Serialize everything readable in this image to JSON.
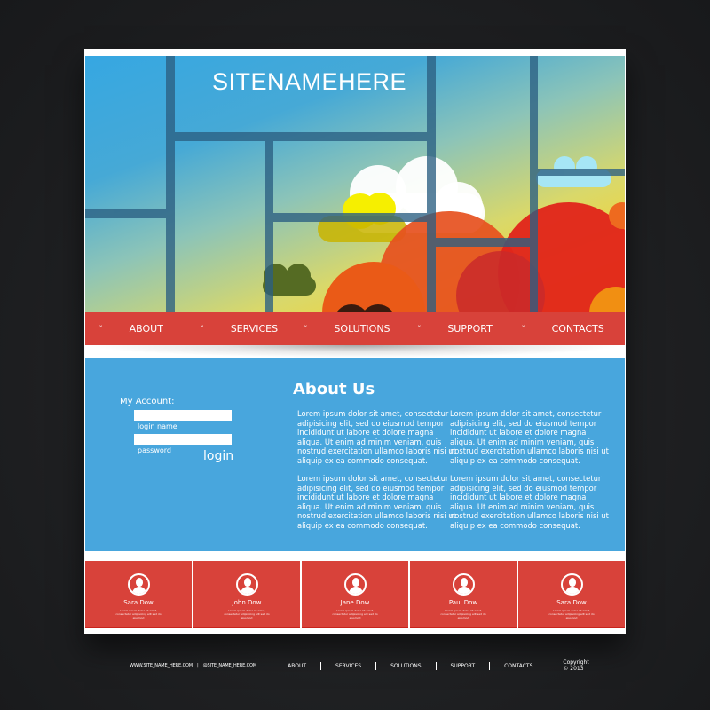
{
  "header": {
    "site_name": "SITENAMEHERE"
  },
  "nav": {
    "items": [
      {
        "label": "ABOUT",
        "icon": "chevron-down-icon"
      },
      {
        "label": "SERVICES",
        "icon": "chevron-down-icon"
      },
      {
        "label": "SOLUTIONS",
        "icon": "chevron-down-icon"
      },
      {
        "label": "SUPPORT",
        "icon": "chevron-down-icon"
      },
      {
        "label": "CONTACTS",
        "icon": "chevron-down-icon"
      }
    ],
    "chevron_glyph": "˅"
  },
  "account": {
    "label": "My Account:",
    "login_name_label": "login name",
    "password_label": "password",
    "login_name_value": "",
    "password_value": "",
    "login_button": "login"
  },
  "about": {
    "title": "About Us",
    "paragraphs": [
      "Lorem ipsum dolor sit amet, consectetur adipisicing elit, sed do eiusmod tempor incididunt ut labore et dolore magna aliqua. Ut enim ad minim veniam, quis nostrud exercitation ullamco laboris nisi ut aliquip ex ea commodo consequat.",
      "Lorem ipsum dolor sit amet, consectetur adipisicing elit, sed do eiusmod tempor incididunt ut labore et dolore magna aliqua. Ut enim ad minim veniam, quis nostrud exercitation ullamco laboris nisi ut aliquip ex ea commodo consequat.",
      "Lorem ipsum dolor sit amet, consectetur adipisicing elit, sed do eiusmod tempor incididunt ut labore et dolore magna aliqua. Ut enim ad minim veniam, quis nostrud exercitation ullamco laboris nisi ut aliquip ex ea commodo consequat.",
      "Lorem ipsum dolor sit amet, consectetur adipisicing elit, sed do eiusmod tempor incididunt ut labore et dolore magna aliqua. Ut enim ad minim veniam, quis nostrud exercitation ullamco laboris nisi ut aliquip ex ea commodo consequat."
    ]
  },
  "team": [
    {
      "name": "Sara Dow",
      "desc": "Lorem ipsum dolor sit amet, consectetur adipisicing elit sed do eiusmod",
      "icon": "user-avatar-icon"
    },
    {
      "name": "John Dow",
      "desc": "Lorem ipsum dolor sit amet, consectetur adipisicing elit sed do eiusmod",
      "icon": "user-avatar-icon"
    },
    {
      "name": "Jane Dow",
      "desc": "Lorem ipsum dolor sit amet, consectetur adipisicing elit sed do eiusmod",
      "icon": "user-avatar-icon"
    },
    {
      "name": "Paul Dow",
      "desc": "Lorem ipsum dolor sit amet, consectetur adipisicing elit sed do eiusmod",
      "icon": "user-avatar-icon"
    },
    {
      "name": "Sara Dow",
      "desc": "Lorem ipsum dolor sit amet, consectetur adipisicing elit sed do eiusmod",
      "icon": "user-avatar-icon"
    }
  ],
  "footer": {
    "website": "WWW.SITE_NAME_HERE.COM",
    "separator": "|",
    "social": "@SITE_NAME_HERE.COM",
    "links": [
      "ABOUT",
      "SERVICES",
      "SOLUTIONS",
      "SUPPORT",
      "CONTACTS"
    ],
    "copyright": "Copyright © 2013"
  },
  "colors": {
    "accent_red": "#d8423a",
    "section_blue": "#48a6dd",
    "background_dark": "#1f2022"
  }
}
